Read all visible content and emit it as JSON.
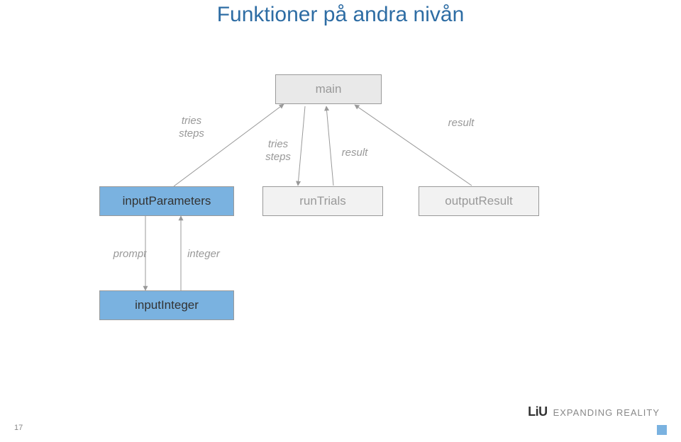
{
  "title": "Funktioner på andra nivån",
  "boxes": {
    "main": "main",
    "inputParameters": "inputParameters",
    "runTrials": "runTrials",
    "outputResult": "outputResult",
    "inputInteger": "inputInteger"
  },
  "edgeLabels": {
    "triesSteps1_line1": "tries",
    "triesSteps1_line2": "steps",
    "triesSteps2_line1": "tries",
    "triesSteps2_line2": "steps",
    "result1": "result",
    "result2": "result",
    "prompt": "prompt",
    "integer": "integer"
  },
  "footer": {
    "logoMain": "LiU",
    "logoTag": "EXPANDING REALITY",
    "pageNumber": "17"
  },
  "colors": {
    "accentBlue": "#7ab2e0",
    "titleBlue": "#2e6da4",
    "grey": "#999"
  }
}
